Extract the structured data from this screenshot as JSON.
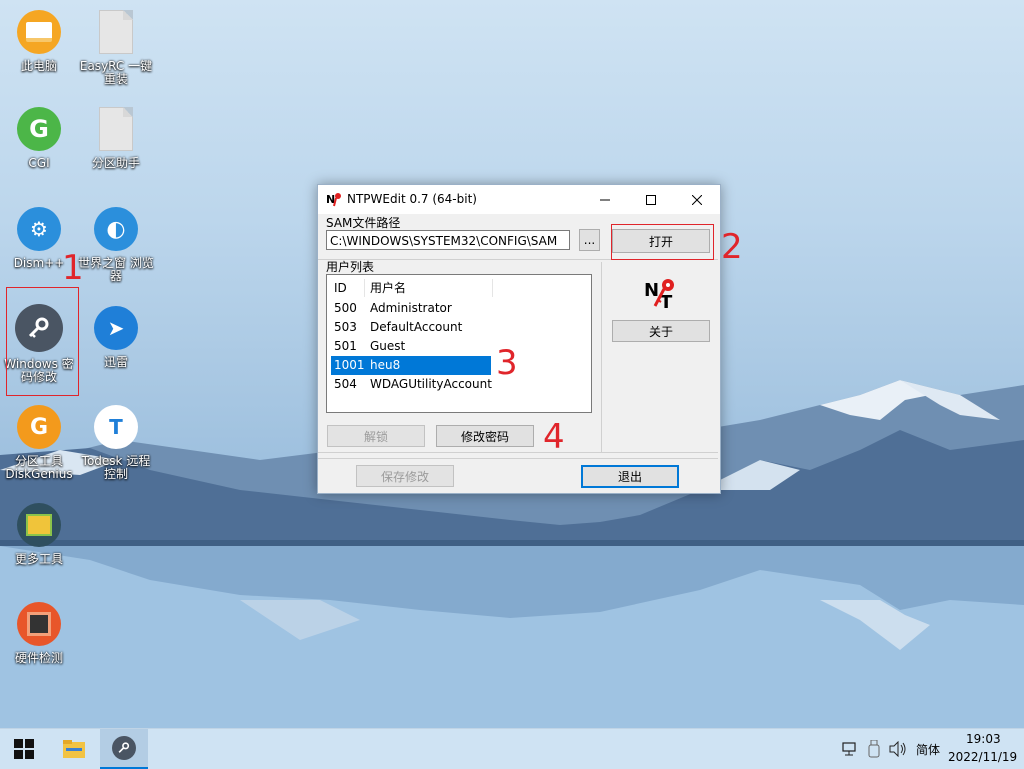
{
  "desktop": {
    "icons": [
      {
        "label": "此电脑"
      },
      {
        "label": "EasyRC 一键重装"
      },
      {
        "label": "CGI"
      },
      {
        "label": "分区助手"
      },
      {
        "label": "Dism++"
      },
      {
        "label": "世界之窗 浏览器"
      },
      {
        "label": "Windows 密码修改"
      },
      {
        "label": "迅雷"
      },
      {
        "label": "分区工具 DiskGenius"
      },
      {
        "label": "Todesk 远程控制"
      },
      {
        "label": "更多工具"
      },
      {
        "label": "硬件检测"
      }
    ],
    "annotations": [
      "1",
      "2",
      "3",
      "4"
    ]
  },
  "window": {
    "title": "NTPWEdit 0.7 (64-bit)",
    "sam_label": "SAM文件路径",
    "sam_path": "C:\\WINDOWS\\SYSTEM32\\CONFIG\\SAM",
    "browse_label": "...",
    "open_label": "打开",
    "user_list_label": "用户列表",
    "columns": [
      "ID",
      "用户名"
    ],
    "users": [
      {
        "id": "500",
        "name": "Administrator"
      },
      {
        "id": "503",
        "name": "DefaultAccount"
      },
      {
        "id": "501",
        "name": "Guest"
      },
      {
        "id": "1001",
        "name": "heu8"
      },
      {
        "id": "504",
        "name": "WDAGUtilityAccount"
      }
    ],
    "selected_user": "heu8",
    "unlock_label": "解锁",
    "change_password_label": "修改密码",
    "about_label": "关于",
    "save_label": "保存修改",
    "exit_label": "退出"
  },
  "taskbar": {
    "ime": "简体",
    "time": "19:03",
    "date": "2022/11/19"
  },
  "colors": {
    "accent": "#0078d7",
    "annotation": "#e0252b"
  }
}
